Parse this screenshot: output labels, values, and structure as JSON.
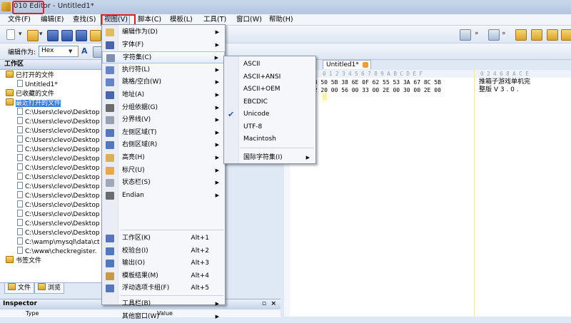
{
  "titlebar": {
    "app_name": "010 Editor",
    "separator": " - ",
    "doc_name": "Untitled1*"
  },
  "menubar": {
    "items": [
      "文件(F)",
      "编辑(E)",
      "查找(S)",
      "视图(V)",
      "脚本(C)",
      "模板(L)",
      "工具(T)",
      "窗口(W)",
      "帮助(H)"
    ]
  },
  "toolbar2": {
    "encoding_label": "编辑作为:",
    "encoding_value": "Hex"
  },
  "workspace": {
    "title": "工作区",
    "items": [
      {
        "kind": "folder",
        "label": "已打开的文件"
      },
      {
        "kind": "file",
        "label": "Untitled1*"
      },
      {
        "kind": "folder",
        "label": "已收藏的文件"
      },
      {
        "kind": "folder",
        "label": "最近打开的文件"
      },
      {
        "kind": "file",
        "label": "C:\\Users\\clevo\\Desktop"
      },
      {
        "kind": "file",
        "label": "C:\\Users\\clevo\\Desktop"
      },
      {
        "kind": "file",
        "label": "C:\\Users\\clevo\\Desktop"
      },
      {
        "kind": "file",
        "label": "C:\\Users\\clevo\\Desktop"
      },
      {
        "kind": "file",
        "label": "C:\\Users\\clevo\\Desktop"
      },
      {
        "kind": "file",
        "label": "C:\\Users\\clevo\\Desktop"
      },
      {
        "kind": "file",
        "label": "C:\\Users\\clevo\\Desktop"
      },
      {
        "kind": "file",
        "label": "C:\\Users\\clevo\\Desktop"
      },
      {
        "kind": "file",
        "label": "C:\\Users\\clevo\\Desktop"
      },
      {
        "kind": "file",
        "label": "C:\\Users\\clevo\\Desktop"
      },
      {
        "kind": "file",
        "label": "C:\\Users\\clevo\\Desktop"
      },
      {
        "kind": "file",
        "label": "C:\\Users\\clevo\\Desktop"
      },
      {
        "kind": "file",
        "label": "C:\\Users\\clevo\\Desktop"
      },
      {
        "kind": "file",
        "label": "C:\\Users\\clevo\\Desktop"
      },
      {
        "kind": "file",
        "label": "C:\\wamp\\mysql\\data\\ct"
      },
      {
        "kind": "file",
        "label": "C:\\www\\checkregister."
      },
      {
        "kind": "folder",
        "label": "书签文件"
      }
    ],
    "selected_index": 3,
    "tabs": [
      "文件",
      "浏览"
    ]
  },
  "inspector": {
    "title": "Inspector",
    "col_type": "Type",
    "col_value": "Value"
  },
  "view_menu": {
    "items": [
      {
        "label": "编辑作为(D)",
        "accel": "",
        "submenu": true,
        "icon_name": "pencil-icon"
      },
      {
        "label": "字体(F)",
        "accel": "",
        "submenu": true,
        "icon_name": "font-icon"
      },
      {
        "label": "字符集(C)",
        "accel": "",
        "submenu": true,
        "icon_name": "charset-icon"
      },
      {
        "label": "执行符(L)",
        "accel": "",
        "submenu": true,
        "icon_name": "linefeed-icon"
      },
      {
        "label": "跳格/空白(W)",
        "accel": "",
        "submenu": true,
        "icon_name": "tab-icon"
      },
      {
        "label": "地址(A)",
        "accel": "",
        "submenu": true,
        "icon_name": "address-icon"
      },
      {
        "label": "分组依据(G)",
        "accel": "",
        "submenu": true,
        "icon_name": "group-icon"
      },
      {
        "label": "分界线(V)",
        "accel": "",
        "submenu": true,
        "icon_name": "divider-icon"
      },
      {
        "label": "左侧区域(T)",
        "accel": "",
        "submenu": true,
        "icon_name": "left-area-icon"
      },
      {
        "label": "右侧区域(R)",
        "accel": "",
        "submenu": true,
        "icon_name": "right-area-icon"
      },
      {
        "label": "高亮(H)",
        "accel": "",
        "submenu": true,
        "icon_name": "highlight-icon"
      },
      {
        "label": "标尺(U)",
        "accel": "",
        "submenu": true,
        "icon_name": "ruler-icon"
      },
      {
        "label": "状态栏(S)",
        "accel": "",
        "submenu": true,
        "icon_name": "statusbar-icon"
      },
      {
        "label": "Endian",
        "accel": "",
        "submenu": true,
        "icon_name": "endian-icon"
      },
      {
        "label": "工作区(K)",
        "accel": "Alt+1",
        "submenu": false,
        "icon_name": "workspace-icon"
      },
      {
        "label": "校验台(I)",
        "accel": "Alt+2",
        "submenu": false,
        "icon_name": "inspector-icon"
      },
      {
        "label": "输出(O)",
        "accel": "Alt+3",
        "submenu": false,
        "icon_name": "output-icon"
      },
      {
        "label": "模板结果(M)",
        "accel": "Alt+4",
        "submenu": false,
        "icon_name": "template-results-icon"
      },
      {
        "label": "浮动选项卡组(F)",
        "accel": "Alt+5",
        "submenu": false,
        "icon_name": "floating-tabs-icon"
      },
      {
        "label": "工具栏(B)",
        "accel": "",
        "submenu": true,
        "icon_name": ""
      },
      {
        "label": "其他窗口(W)",
        "accel": "",
        "submenu": true,
        "icon_name": ""
      }
    ],
    "hot_index": 2
  },
  "charset_menu": {
    "items": [
      {
        "label": "ASCII",
        "checked": false,
        "submenu": false
      },
      {
        "label": "ASCII+ANSI",
        "checked": false,
        "submenu": false
      },
      {
        "label": "ASCII+OEM",
        "checked": false,
        "submenu": false
      },
      {
        "label": "EBCDIC",
        "checked": false,
        "submenu": false
      },
      {
        "label": "Unicode",
        "checked": true,
        "submenu": false
      },
      {
        "label": "UTF-8",
        "checked": false,
        "submenu": false
      },
      {
        "label": "Macintosh",
        "checked": false,
        "submenu": false
      },
      {
        "label": "国际字符集(I)",
        "checked": false,
        "submenu": true
      }
    ]
  },
  "editor": {
    "tab_label": "Untitled1*",
    "hex_ruler": "0  1  2  3  4  5  6  7  8  9  A  B  C  D  E  F",
    "ascii_ruler": "0 2 4 6 8 A C E",
    "hex_rows": [
      "63 B1 7B 50 5B 38 6E 0F 62 55 53 3A 67 8C 5B",
      "45 68 72 20 00 56 00 33 00 2E 00 30 00 2E 00"
    ],
    "ascii_rows": [
      "推箱子游戏单机完",
      "整版  V 3 . 0 ."
    ]
  },
  "colors": {
    "selection": "#3e7bd3",
    "highlight_border": "#e01f1f",
    "check": "#2a5ab8"
  }
}
